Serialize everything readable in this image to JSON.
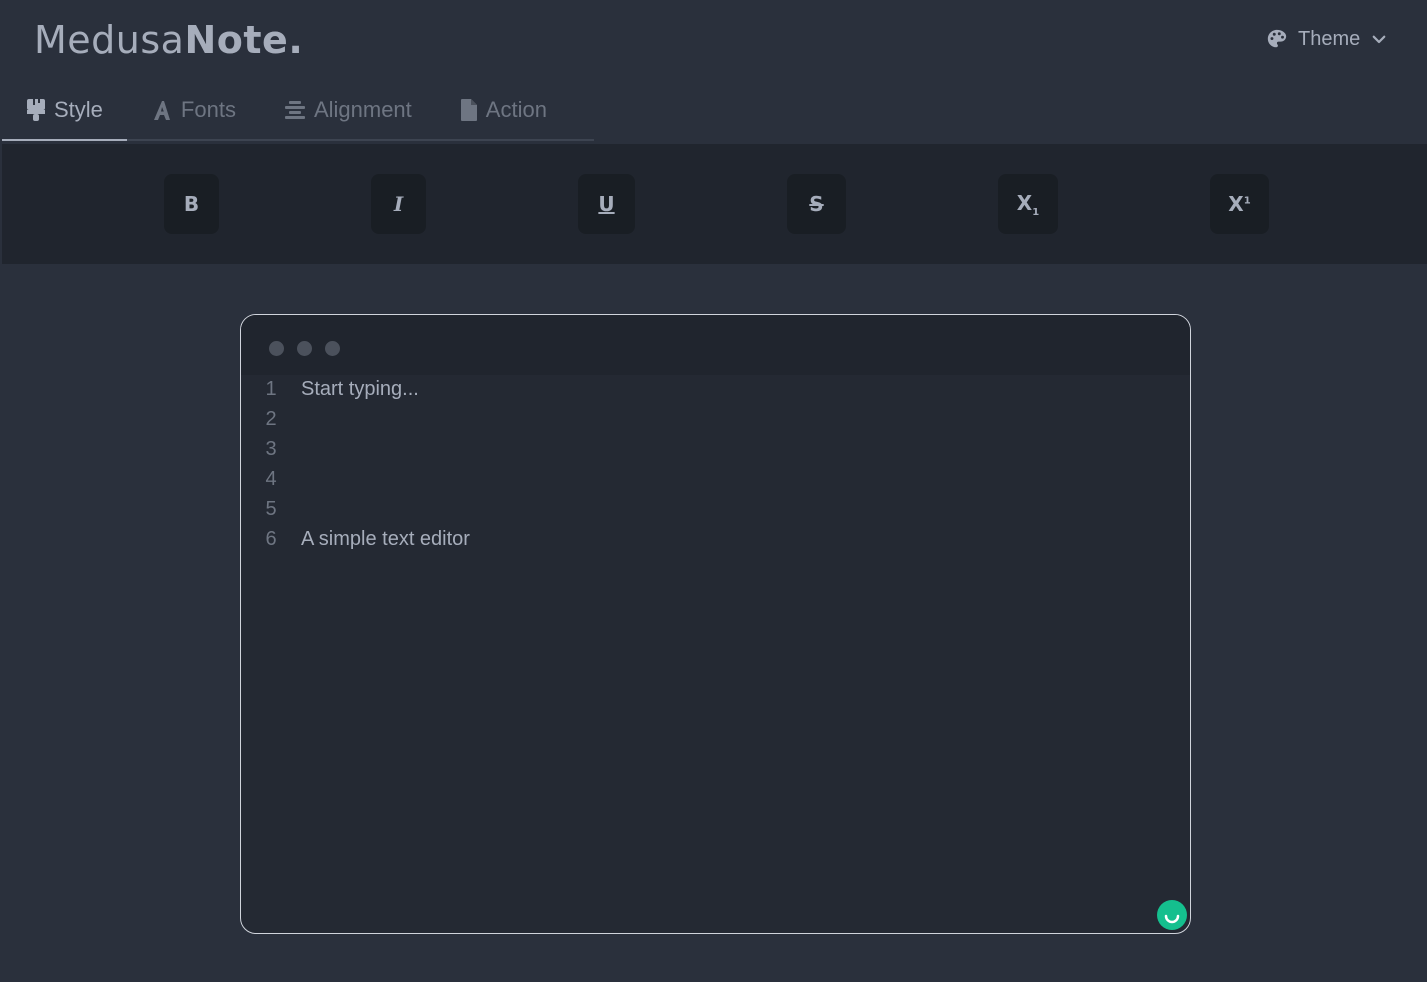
{
  "app": {
    "logo_light": "Medusa",
    "logo_bold": "Note."
  },
  "theme": {
    "label": "Theme",
    "icon": "palette-icon",
    "chevron": "chevron-down-icon"
  },
  "tabs": [
    {
      "label": "Style",
      "icon": "brush-icon",
      "active": true
    },
    {
      "label": "Fonts",
      "icon": "font-icon",
      "active": false
    },
    {
      "label": "Alignment",
      "icon": "align-center-icon",
      "active": false
    },
    {
      "label": "Action",
      "icon": "file-icon",
      "active": false
    }
  ],
  "toolbar": {
    "bold": "B",
    "italic": "I",
    "underline": "U",
    "strike": "S",
    "subscript": "X",
    "subscript_mark": "1",
    "superscript": "X",
    "superscript_mark": "1"
  },
  "editor": {
    "lines": [
      {
        "number": "1",
        "text": "Start typing..."
      },
      {
        "number": "2",
        "text": ""
      },
      {
        "number": "3",
        "text": ""
      },
      {
        "number": "4",
        "text": ""
      },
      {
        "number": "5",
        "text": ""
      },
      {
        "number": "6",
        "text": "A simple text editor"
      }
    ]
  },
  "colors": {
    "background": "#2a303c",
    "toolbar": "#20252e",
    "button": "#191e24",
    "text": "#a6adbb",
    "accent": "#15bf8e"
  }
}
